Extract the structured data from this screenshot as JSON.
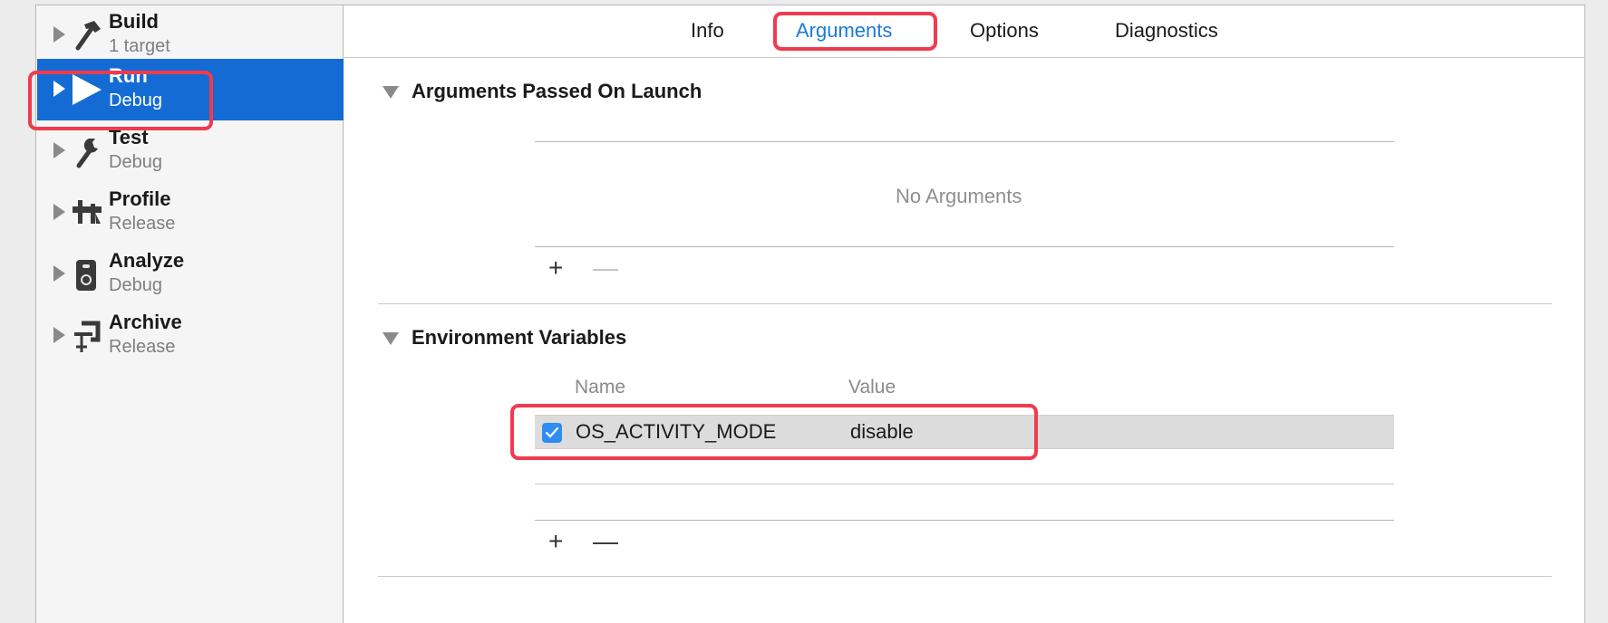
{
  "sidebar": {
    "items": [
      {
        "title": "Build",
        "subtitle": "1 target",
        "icon": "hammer-icon"
      },
      {
        "title": "Run",
        "subtitle": "Debug",
        "icon": "play-icon"
      },
      {
        "title": "Test",
        "subtitle": "Debug",
        "icon": "wrench-icon"
      },
      {
        "title": "Profile",
        "subtitle": "Release",
        "icon": "caliper-icon"
      },
      {
        "title": "Analyze",
        "subtitle": "Debug",
        "icon": "analyzer-icon"
      },
      {
        "title": "Archive",
        "subtitle": "Release",
        "icon": "clamp-icon"
      }
    ],
    "selected": "Run",
    "selection_color": "#146bd3"
  },
  "tabs": [
    {
      "label": "Info"
    },
    {
      "label": "Arguments"
    },
    {
      "label": "Options"
    },
    {
      "label": "Diagnostics"
    }
  ],
  "active_tab": "Arguments",
  "arguments": {
    "title": "Arguments Passed On Launch",
    "empty_message": "No Arguments",
    "add": "+",
    "remove": "—"
  },
  "environment": {
    "title": "Environment Variables",
    "columns": {
      "name": "Name",
      "value": "Value"
    },
    "rows": [
      {
        "enabled": true,
        "name": "OS_ACTIVITY_MODE",
        "value": "disable"
      }
    ],
    "add": "+",
    "remove": "—"
  },
  "colors": {
    "accent": "#1b7ad9",
    "highlight": "#f03b4f",
    "checkbox": "#2f8cf2"
  }
}
